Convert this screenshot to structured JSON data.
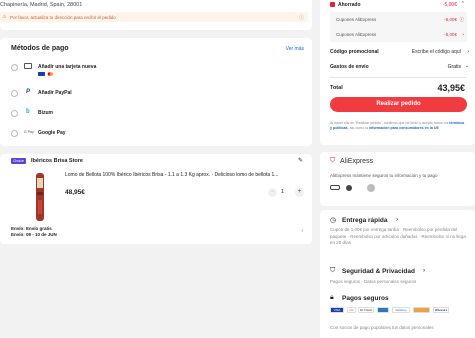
{
  "address": {
    "line": "Chapinería, Madrid, Spain, 28001",
    "alert": "Por favor, actualiza tu dirección para recibir el pedido"
  },
  "payment": {
    "title": "Métodos de pago",
    "see_more": "Ver más",
    "methods": [
      {
        "label": "Añadir una tarjeta nueva"
      },
      {
        "label": "Añadir PayPal"
      },
      {
        "label": "Bizum"
      },
      {
        "label": "Google Pay"
      }
    ],
    "gpay_icon": "G Pay"
  },
  "store": {
    "badge": "Choice",
    "name": "Ibéricos Brisa Store",
    "product_title": "Lomo de Bellota 100% Ibérico Ibéricos Brisa - 1.1 a 1.3 Kg aprox. - Delicioso lomo de bellota 1...",
    "price": "48,95€",
    "quantity": "1",
    "shipping_line1": "Envío: Envío gratis",
    "shipping_line2": "Envío: 09 - 10 de JUN"
  },
  "summary": {
    "ahorrado_label": "Ahorrado",
    "ahorrado_value": "-5,00€",
    "coupon1_label": "Cupones AliExpress",
    "coupon1_value": "-5,00€",
    "coupon2_label": "Cupones AliExpress",
    "coupon2_value": "-5,00€",
    "promo_label": "Código promocional",
    "promo_value": "Escribe el código aquí",
    "shipping_label": "Gastos de envío",
    "shipping_value": "Gratis",
    "total_label": "Total",
    "total_value": "43,95€",
    "place_order": "Realizar pedido",
    "legal": "Al hacer clic en 'Realizar pedido', confirmo que he leído y acepto todos los",
    "legal_link1": "términos y políticas",
    "legal_mid": ", así como la",
    "legal_link2": "información para consumidores en la UE"
  },
  "trust": {
    "brand": "AliExpress",
    "text": "AliExpress mantiene seguros tu información y tu pago",
    "delivery_title": "Entrega rápida",
    "delivery_text": "Cupón de 1,00€ por entrega tardía  ·  Reembolso por pérdida del paquete  ·  Reembolso por artículos dañados  ·  Reembolso si no llega en 20 días",
    "security_title": "Seguridad & Privacidad",
    "security_text": "Pagos seguros  ·  Datos personales seguros",
    "pay_title": "Pagos seguros",
    "pay_logos": [
      "VISA",
      "mc",
      "ID Check",
      "",
      "SafeKey",
      "",
      "J/Secure"
    ],
    "pay_text": "Con socios de pago populares tus datos personales"
  },
  "colors": {
    "accent": "#e8222d",
    "choice_badge": "#5c43d6",
    "bg": "#f2f2f2"
  }
}
